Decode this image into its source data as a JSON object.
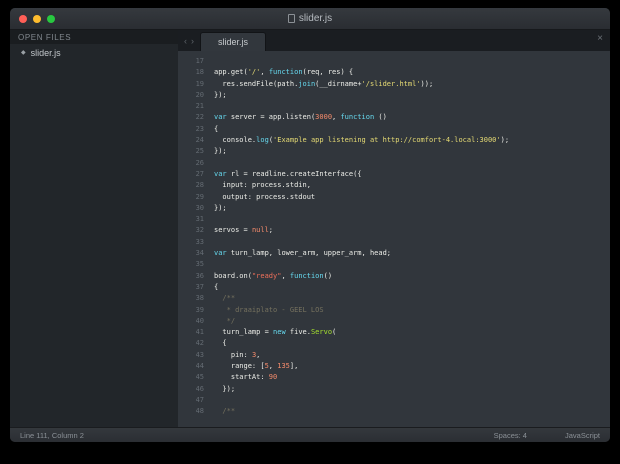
{
  "window": {
    "title": "slider.js"
  },
  "sidebar": {
    "header": "OPEN FILES",
    "items": [
      {
        "label": "slider.js",
        "bullet": "◆"
      }
    ]
  },
  "tabbar": {
    "back_icon": "‹",
    "forward_icon": "›",
    "close_icon": "×",
    "tabs": [
      {
        "label": "slider.js",
        "active": true
      }
    ]
  },
  "statusbar": {
    "position": "Line 111, Column 2",
    "spaces": "Spaces: 4",
    "language": "JavaScript"
  },
  "colors": {
    "keyword": "#66d9ef",
    "string": "#e6db74",
    "string_alt": "#f0705a",
    "number": "#f78c6c",
    "class_name": "#a6e22e",
    "comment": "#75715e",
    "editor_bg": "#31363c",
    "sidebar_bg": "#22262a"
  },
  "editor": {
    "lines": [
      {
        "n": 17,
        "toks": []
      },
      {
        "n": 18,
        "toks": [
          [
            "p",
            "app.get("
          ],
          [
            "s",
            "'/'"
          ],
          [
            "p",
            ", "
          ],
          [
            "k",
            "function"
          ],
          [
            "p",
            "(req, res) {"
          ]
        ]
      },
      {
        "n": 19,
        "toks": [
          [
            "p",
            "  res.sendFile(path."
          ],
          [
            "fn",
            "join"
          ],
          [
            "p",
            "(__dirname+"
          ],
          [
            "s",
            "'/slider.html'"
          ],
          [
            "p",
            "));"
          ]
        ]
      },
      {
        "n": 20,
        "toks": [
          [
            "p",
            "});"
          ]
        ]
      },
      {
        "n": 21,
        "toks": []
      },
      {
        "n": 22,
        "toks": [
          [
            "k",
            "var"
          ],
          [
            "p",
            " server = app.listen("
          ],
          [
            "n",
            "3000"
          ],
          [
            "p",
            ", "
          ],
          [
            "k",
            "function"
          ],
          [
            "p",
            " ()"
          ]
        ]
      },
      {
        "n": 23,
        "toks": [
          [
            "p",
            "{"
          ]
        ]
      },
      {
        "n": 24,
        "toks": [
          [
            "p",
            "  console."
          ],
          [
            "fn",
            "log"
          ],
          [
            "p",
            "("
          ],
          [
            "s",
            "'Example app listening at http://comfort-4.local:3000'"
          ],
          [
            "p",
            ");"
          ]
        ]
      },
      {
        "n": 25,
        "toks": [
          [
            "p",
            "});"
          ]
        ]
      },
      {
        "n": 26,
        "toks": []
      },
      {
        "n": 27,
        "toks": [
          [
            "k",
            "var"
          ],
          [
            "p",
            " rl = readline.createInterface({"
          ]
        ]
      },
      {
        "n": 28,
        "toks": [
          [
            "p",
            "  input: process.stdin,"
          ]
        ]
      },
      {
        "n": 29,
        "toks": [
          [
            "p",
            "  output: process.stdout"
          ]
        ]
      },
      {
        "n": 30,
        "toks": [
          [
            "p",
            "});"
          ]
        ]
      },
      {
        "n": 31,
        "toks": []
      },
      {
        "n": 32,
        "toks": [
          [
            "p",
            "servos = "
          ],
          [
            "n",
            "null"
          ],
          [
            "p",
            ";"
          ]
        ]
      },
      {
        "n": 33,
        "toks": []
      },
      {
        "n": 34,
        "toks": [
          [
            "k",
            "var"
          ],
          [
            "p",
            " turn_lamp, lower_arm, upper_arm, head;"
          ]
        ]
      },
      {
        "n": 35,
        "toks": []
      },
      {
        "n": 36,
        "toks": [
          [
            "p",
            "board.on("
          ],
          [
            "sr",
            "\"ready\""
          ],
          [
            "p",
            ", "
          ],
          [
            "k",
            "function"
          ],
          [
            "p",
            "()"
          ]
        ]
      },
      {
        "n": 37,
        "toks": [
          [
            "p",
            "{"
          ]
        ]
      },
      {
        "n": 38,
        "toks": [
          [
            "c",
            "  /**"
          ]
        ]
      },
      {
        "n": 39,
        "toks": [
          [
            "c",
            "   * draaiplato - GEEL LOS"
          ]
        ]
      },
      {
        "n": 40,
        "toks": [
          [
            "c",
            "   */"
          ]
        ]
      },
      {
        "n": 41,
        "toks": [
          [
            "p",
            "  turn_lamp = "
          ],
          [
            "k",
            "new"
          ],
          [
            "p",
            " five."
          ],
          [
            "cls",
            "Servo"
          ],
          [
            "p",
            "("
          ]
        ]
      },
      {
        "n": 42,
        "toks": [
          [
            "p",
            "  {"
          ]
        ]
      },
      {
        "n": 43,
        "toks": [
          [
            "p",
            "    pin: "
          ],
          [
            "n",
            "3"
          ],
          [
            "p",
            ","
          ]
        ]
      },
      {
        "n": 44,
        "toks": [
          [
            "p",
            "    range: ["
          ],
          [
            "n",
            "5"
          ],
          [
            "p",
            ", "
          ],
          [
            "n",
            "135"
          ],
          [
            "p",
            "],"
          ]
        ]
      },
      {
        "n": 45,
        "toks": [
          [
            "p",
            "    startAt: "
          ],
          [
            "n",
            "90"
          ]
        ]
      },
      {
        "n": 46,
        "toks": [
          [
            "p",
            "  });"
          ]
        ]
      },
      {
        "n": 47,
        "toks": []
      },
      {
        "n": 48,
        "toks": [
          [
            "c",
            "  /**"
          ]
        ]
      }
    ]
  }
}
